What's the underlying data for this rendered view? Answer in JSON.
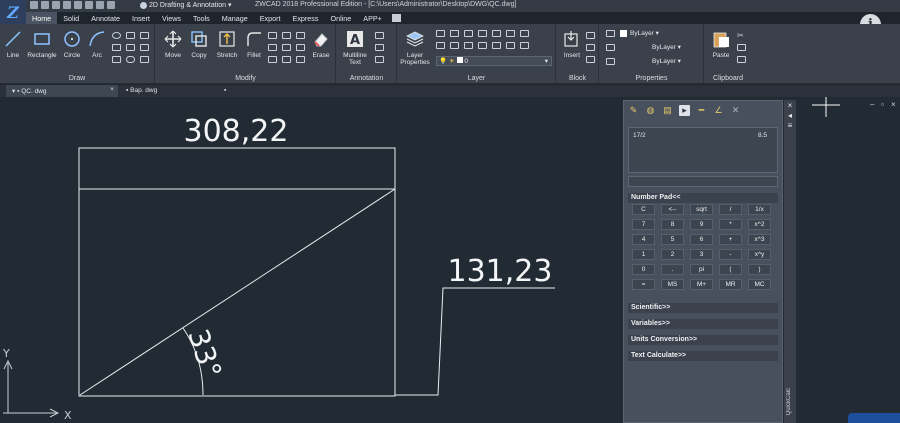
{
  "titlebar": {
    "workspace": "2D Drafting & Annotation",
    "document_title": "ZWCAD 2018 Professional Edition - [C:\\Users\\Administrator\\Desktop\\DWG\\QC.dwg]"
  },
  "ribbon_tabs": [
    "Home",
    "Solid",
    "Annotate",
    "Insert",
    "Views",
    "Tools",
    "Manage",
    "Export",
    "Express",
    "Online",
    "APP+"
  ],
  "panels": {
    "draw": {
      "title": "Draw",
      "line": "Line",
      "rectangle": "Rectangle",
      "circle": "Circle",
      "arc": "Arc"
    },
    "modify": {
      "title": "Modify",
      "move": "Move",
      "copy": "Copy",
      "stretch": "Stretch",
      "fillet": "Fillet",
      "erase": "Erase"
    },
    "annotation": {
      "title": "Annotation",
      "multiline_text_1": "Multiline",
      "multiline_text_2": "Text"
    },
    "layer": {
      "title": "Layer",
      "layer_properties_1": "Layer",
      "layer_properties_2": "Properties",
      "current_layer": "0"
    },
    "block": {
      "title": "Block",
      "insert": "Insert"
    },
    "properties": {
      "title": "Properties",
      "color": "ByLayer",
      "linetype": "ByLayer",
      "lineweight": "ByLayer"
    },
    "clipboard": {
      "title": "Clipboard",
      "paste": "Paste"
    }
  },
  "doc_tabs": [
    {
      "label": "QC. dwg",
      "close": "×"
    },
    {
      "label": "Bap. dwg"
    }
  ],
  "drawing": {
    "dim_top": "308,22",
    "dim_right": "131,23",
    "angle": "33°",
    "ucs_x": "X",
    "ucs_y": "Y"
  },
  "calculator": {
    "history_expression": "17/2",
    "history_result": "8.5",
    "number_pad_label": "Number Pad<<",
    "keys": [
      "C",
      "<--",
      "sqrt",
      "/",
      "1/x",
      "7",
      "8",
      "9",
      "*",
      "x^2",
      "4",
      "5",
      "6",
      "+",
      "x^3",
      "1",
      "2",
      "3",
      "-",
      "x^y",
      "0",
      ".",
      "pi",
      "(",
      ")",
      "=",
      "MS",
      "M+",
      "MR",
      "MC"
    ],
    "scientific_label": "Scientific>>",
    "variables_label": "Variables>>",
    "units_label": "Units Conversion>>",
    "text_calc_label": "Text Calculate>>",
    "side_title": "QuickCalc"
  },
  "info_button": "i"
}
